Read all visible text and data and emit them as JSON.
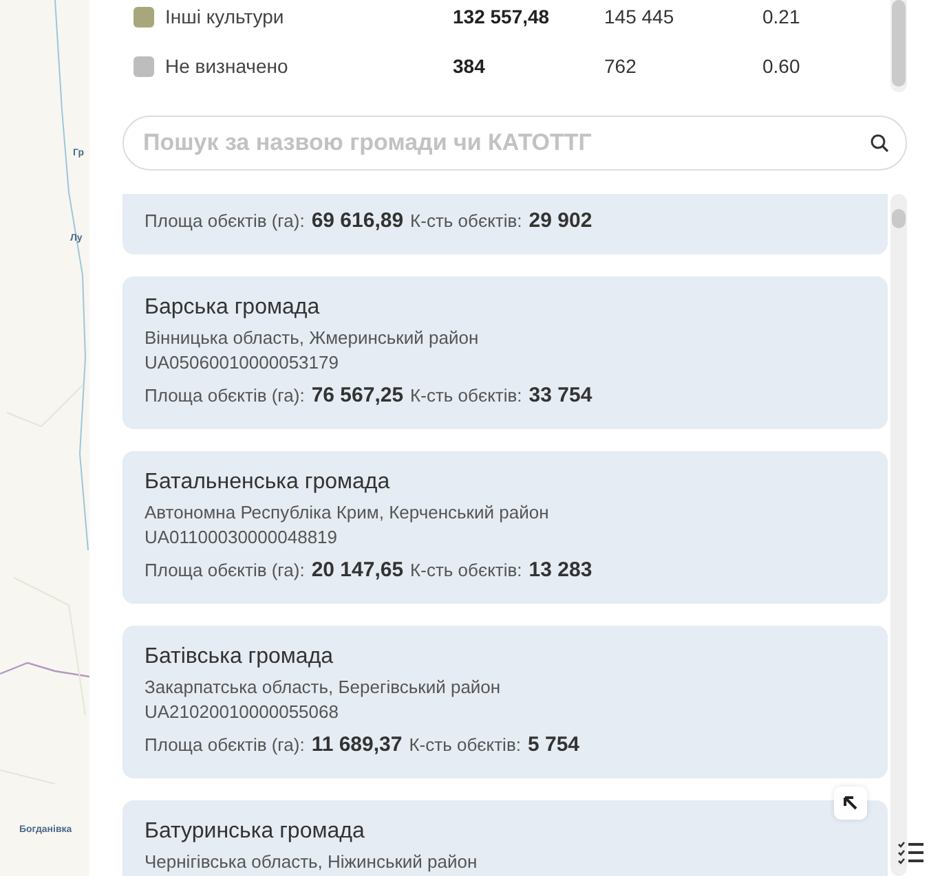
{
  "map": {
    "labels": [
      "Гр",
      "Лу",
      "Богданівка"
    ]
  },
  "legend_table": {
    "rows": [
      {
        "name": "Інші культури",
        "color": "#a8a77c",
        "area": "132 557,48",
        "count": "145 445",
        "ratio": "0.21"
      },
      {
        "name": "Не визначено",
        "color": "#bdbdbd",
        "area": "384",
        "count": "762",
        "ratio": "0.60"
      }
    ]
  },
  "search": {
    "placeholder": "Пошук за назвою громади чи КАТОТТГ"
  },
  "communities": [
    {
      "area_label": "Площа обєктів (га):",
      "area": "69 616,89",
      "count_label": "К-сть обєктів:",
      "count": "29 902"
    },
    {
      "title": "Барська громада",
      "region": "Вінницька область, Жмеринський район",
      "code": "UA05060010000053179",
      "area_label": "Площа обєктів (га):",
      "area": "76 567,25",
      "count_label": "К-сть обєктів:",
      "count": "33 754"
    },
    {
      "title": "Батальненська громада",
      "region": "Автономна Республіка Крим, Керченський район",
      "code": "UA01100030000048819",
      "area_label": "Площа обєктів (га):",
      "area": "20 147,65",
      "count_label": "К-сть обєктів:",
      "count": "13 283"
    },
    {
      "title": "Батівська громада",
      "region": "Закарпатська область, Берегівський район",
      "code": "UA21020010000055068",
      "area_label": "Площа обєктів (га):",
      "area": "11 689,37",
      "count_label": "К-сть обєктів:",
      "count": "5 754"
    },
    {
      "title": "Батуринська громада",
      "region": "Чернігівська область, Ніжинський район"
    }
  ]
}
